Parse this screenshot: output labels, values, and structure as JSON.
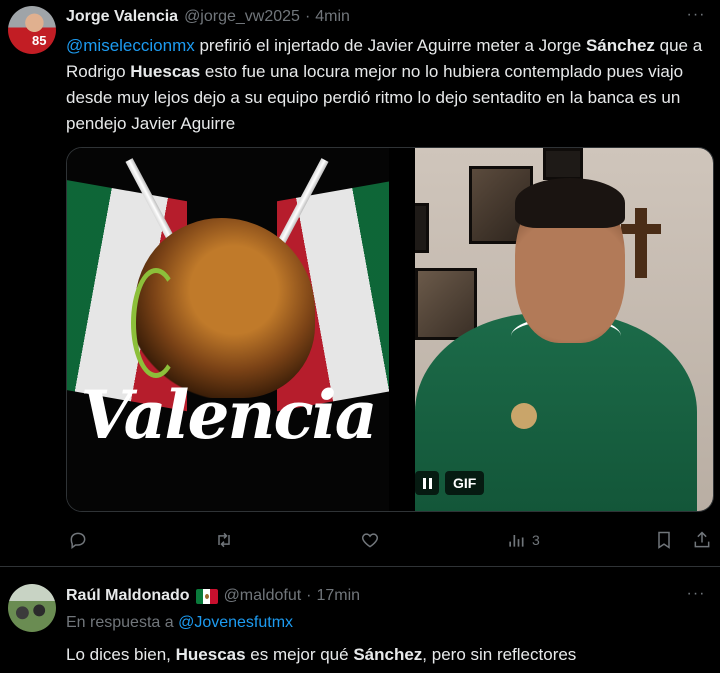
{
  "tweet1": {
    "author_name": "Jorge Valencia",
    "handle": "@jorge_vw2025",
    "separator": "·",
    "time": "4min",
    "avatar_number": "85",
    "text": {
      "mention": "@miseleccionmx",
      "p1": " prefirió el injertado de Javier Aguirre meter a Jorge ",
      "b1": "Sánchez",
      "p2": " que a Rodrigo ",
      "b2": "Huescas",
      "p3": " esto fue una locura mejor no lo hubiera contemplado pues viajo desde muy lejos dejo a su equipo perdió ritmo lo dejo sentadito en la banca es un pendejo Javier Aguirre"
    },
    "media": {
      "left_image_text": "Valencia",
      "gif_label": "GIF"
    },
    "actions": {
      "views_count": "3"
    }
  },
  "tweet2": {
    "author_name": "Raúl Maldonado",
    "handle": "@maldofut",
    "separator": "·",
    "time": "17min",
    "reply_prefix": "En respuesta a ",
    "reply_to": "@Jovenesfutmx",
    "text": {
      "p1": "Lo  dices bien, ",
      "b1": "Huescas",
      "p2": " es mejor qué ",
      "b2": "Sánchez",
      "p3": ", pero sin reflectores"
    }
  },
  "colors": {
    "background": "#000000",
    "text_primary": "#e7e9ea",
    "text_secondary": "#71767b",
    "link": "#1d9bf0",
    "border": "#2f3336"
  },
  "icons": [
    "more-icon",
    "reply-icon",
    "retweet-icon",
    "like-icon",
    "views-icon",
    "bookmark-icon",
    "share-icon",
    "pause-icon",
    "mexico-flag-icon"
  ]
}
